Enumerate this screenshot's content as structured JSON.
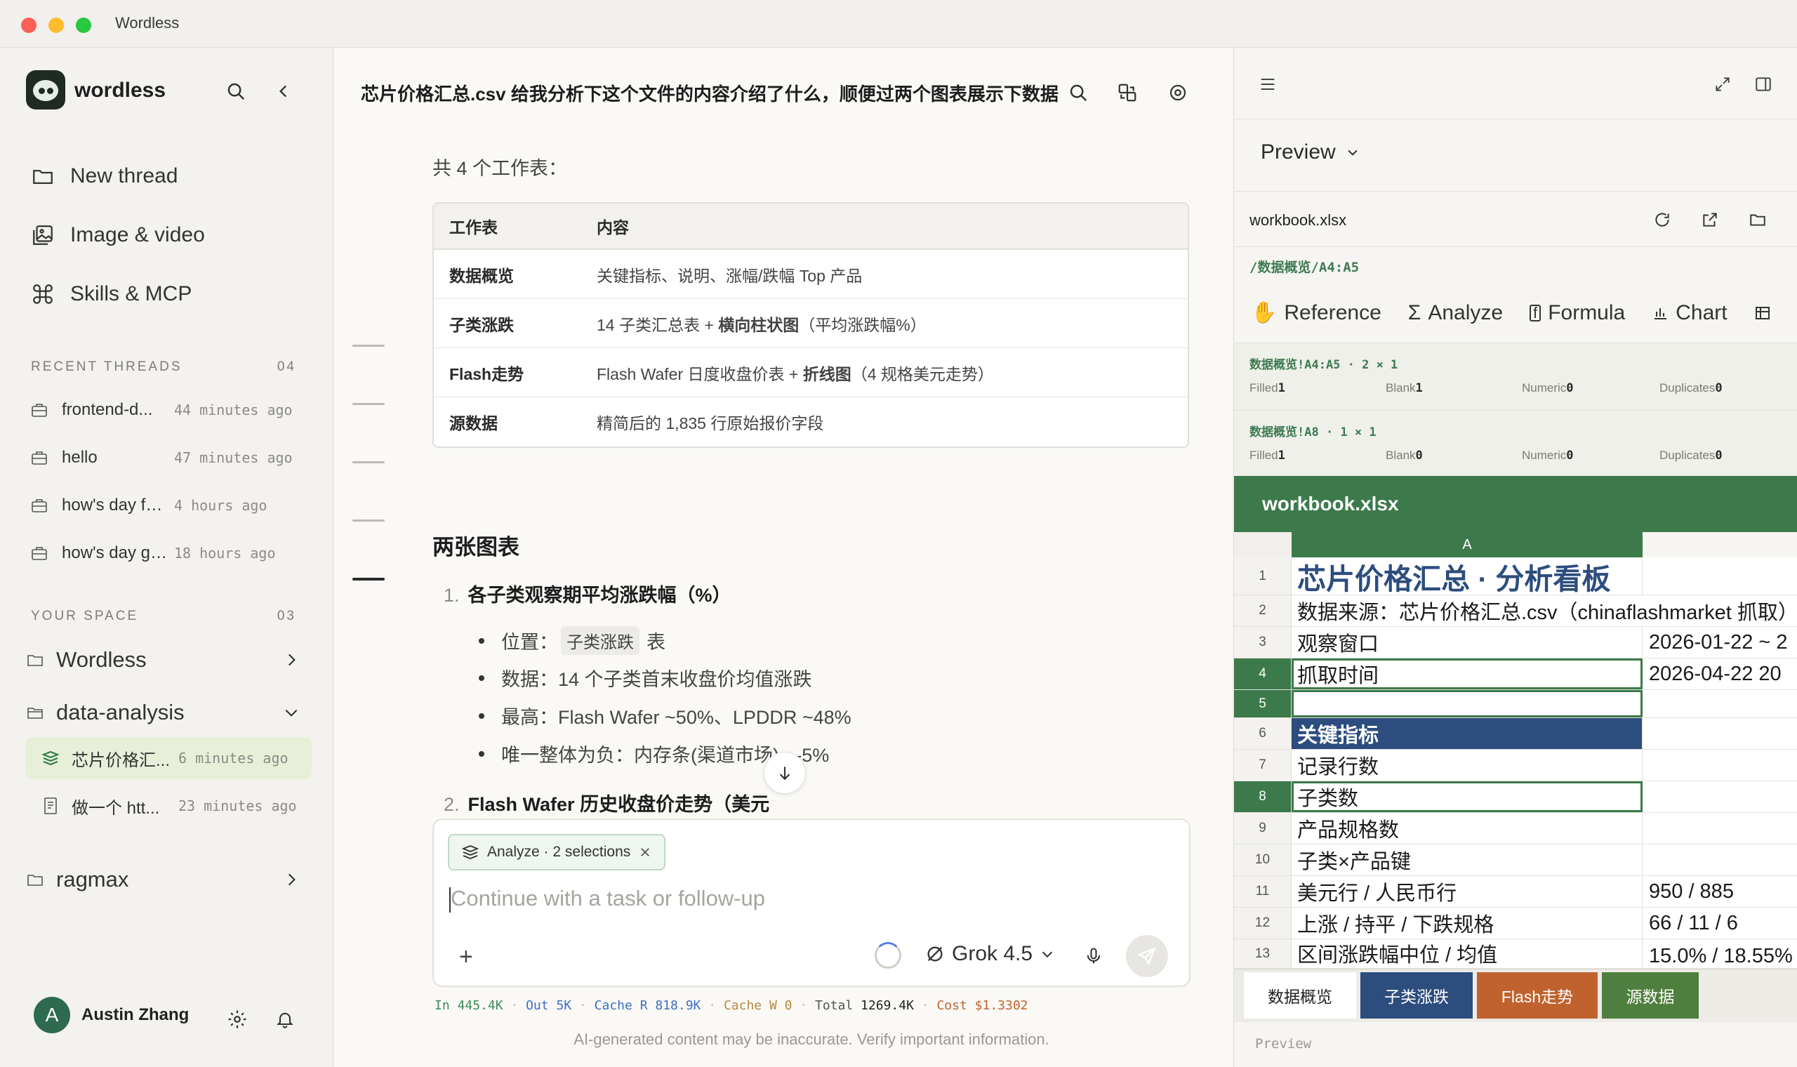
{
  "window": {
    "title": "Wordless"
  },
  "sidebar": {
    "brand": "wordless",
    "nav": [
      {
        "label": "New thread",
        "icon": "folder-icon"
      },
      {
        "label": "Image & video",
        "icon": "image-icon"
      },
      {
        "label": "Skills & MCP",
        "icon": "command-icon"
      }
    ],
    "recent": {
      "heading": "RECENT THREADS",
      "count": "04",
      "items": [
        {
          "title": "frontend-d...",
          "time": "44 minutes ago"
        },
        {
          "title": "hello",
          "time": "47 minutes ago"
        },
        {
          "title": "how's day feeli...",
          "time": "4 hours ago"
        },
        {
          "title": "how's day goi...",
          "time": "18 hours ago"
        }
      ]
    },
    "space": {
      "heading": "YOUR SPACE",
      "count": "03",
      "folders": [
        {
          "name": "Wordless"
        },
        {
          "name": "data-analysis"
        },
        {
          "name": "ragmax"
        }
      ],
      "sub_threads": [
        {
          "title": "芯片价格汇...",
          "time": "6 minutes ago"
        },
        {
          "title": "做一个 htt...",
          "time": "23 minutes ago"
        }
      ]
    },
    "user": {
      "initial": "A",
      "name": "Austin Zhang"
    }
  },
  "chat": {
    "title": "芯片价格汇总.csv 给我分析下这个文件的内容介绍了什么，顺便过两个图表展示下数据",
    "sheets_note": "共 4 个工作表：",
    "table": {
      "headers": [
        "工作表",
        "内容"
      ],
      "rows": [
        {
          "sheet": "数据概览",
          "content": "关键指标、说明、涨幅/跌幅 Top 产品",
          "bold": ""
        },
        {
          "sheet": "子类涨跌",
          "content": "14 子类汇总表 + ",
          "bold": "横向柱状图",
          "tail": "（平均涨跌幅%）"
        },
        {
          "sheet": "Flash走势",
          "content": "Flash Wafer 日度收盘价表 + ",
          "bold": "折线图",
          "tail": "（4 规格美元走势）"
        },
        {
          "sheet": "源数据",
          "content": "精简后的 1,835 行原始报价字段",
          "bold": ""
        }
      ]
    },
    "charts_heading": "两张图表",
    "item1": {
      "num": "1.",
      "title": "各子类观察期平均涨跌幅（%）"
    },
    "bullets": {
      "b1_prefix": "位置：",
      "b1_chip": "子类涨跌",
      "b1_suffix": "表",
      "b2": "数据：14 个子类首末收盘价均值涨跌",
      "b3": "最高：Flash Wafer ~50%、LPDDR ~48%",
      "b4": "唯一整体为负：内存条(渠道市场) ~-5%"
    },
    "item2": {
      "num": "2.",
      "title": "Flash Wafer 历史收盘价走势（美元"
    },
    "composer": {
      "chip": "Analyze · 2 selections",
      "placeholder": "Continue with a task or follow-up",
      "model": "Grok 4.5"
    },
    "usage": {
      "in_label": "In",
      "in": "445.4K",
      "out_label": "Out",
      "out": "5K",
      "cr_label": "Cache R",
      "cr": "818.9K",
      "cw_label": "Cache W",
      "cw": "0",
      "total_label": "Total",
      "total": "1269.4K",
      "cost_label": "Cost",
      "cost": "$1.3302"
    },
    "disclaimer": "AI-generated content may be inaccurate. Verify important information."
  },
  "panel": {
    "mode": "Preview",
    "file": "workbook.xlsx",
    "path": "/数据概览/A4:A5",
    "tools": [
      "Reference",
      "Analyze",
      "Formula",
      "Chart"
    ],
    "selections": [
      {
        "ref": "数据概览!A4:A5 · 2 × 1",
        "filled": "1",
        "blank": "1",
        "numeric": "0",
        "duplicates": "0"
      },
      {
        "ref": "数据概览!A8 · 1 × 1",
        "filled": "1",
        "blank": "0",
        "numeric": "0",
        "duplicates": "0"
      }
    ],
    "stat_labels": {
      "filled": "Filled",
      "blank": "Blank",
      "numeric": "Numeric",
      "duplicates": "Duplicates"
    },
    "workbook_title": "workbook.xlsx",
    "column_a": "A",
    "rows": [
      {
        "n": "1",
        "a": "芯片价格汇总 · 分析看板",
        "b": ""
      },
      {
        "n": "2",
        "a": "数据来源：芯片价格汇总.csv（chinaflashmarket 抓取）",
        "b": ""
      },
      {
        "n": "3",
        "a": "观察窗口",
        "b": "2026-01-22 ~ 2"
      },
      {
        "n": "4",
        "a": "抓取时间",
        "b": "2026-04-22 20"
      },
      {
        "n": "5",
        "a": "",
        "b": ""
      },
      {
        "n": "6",
        "a": "关键指标",
        "b": ""
      },
      {
        "n": "7",
        "a": "记录行数",
        "b": ""
      },
      {
        "n": "8",
        "a": "子类数",
        "b": ""
      },
      {
        "n": "9",
        "a": "产品规格数",
        "b": ""
      },
      {
        "n": "10",
        "a": "子类×产品键",
        "b": ""
      },
      {
        "n": "11",
        "a": "美元行 / 人民币行",
        "b": "950 / 885"
      },
      {
        "n": "12",
        "a": "上涨 / 持平 / 下跌规格",
        "b": "66 / 11 / 6"
      },
      {
        "n": "13",
        "a": "区间涨跌幅中位 / 均值",
        "b": "15.0% / 18.55%"
      }
    ],
    "tabs": [
      {
        "label": "数据概览",
        "bg": "#ffffff",
        "fg": "#222222"
      },
      {
        "label": "子类涨跌",
        "bg": "#2c4d7e",
        "fg": "#ffffff"
      },
      {
        "label": "Flash走势",
        "bg": "#c0622d",
        "fg": "#ffffff"
      },
      {
        "label": "源数据",
        "bg": "#4f7f3e",
        "fg": "#ffffff"
      }
    ],
    "footer": "Preview"
  }
}
